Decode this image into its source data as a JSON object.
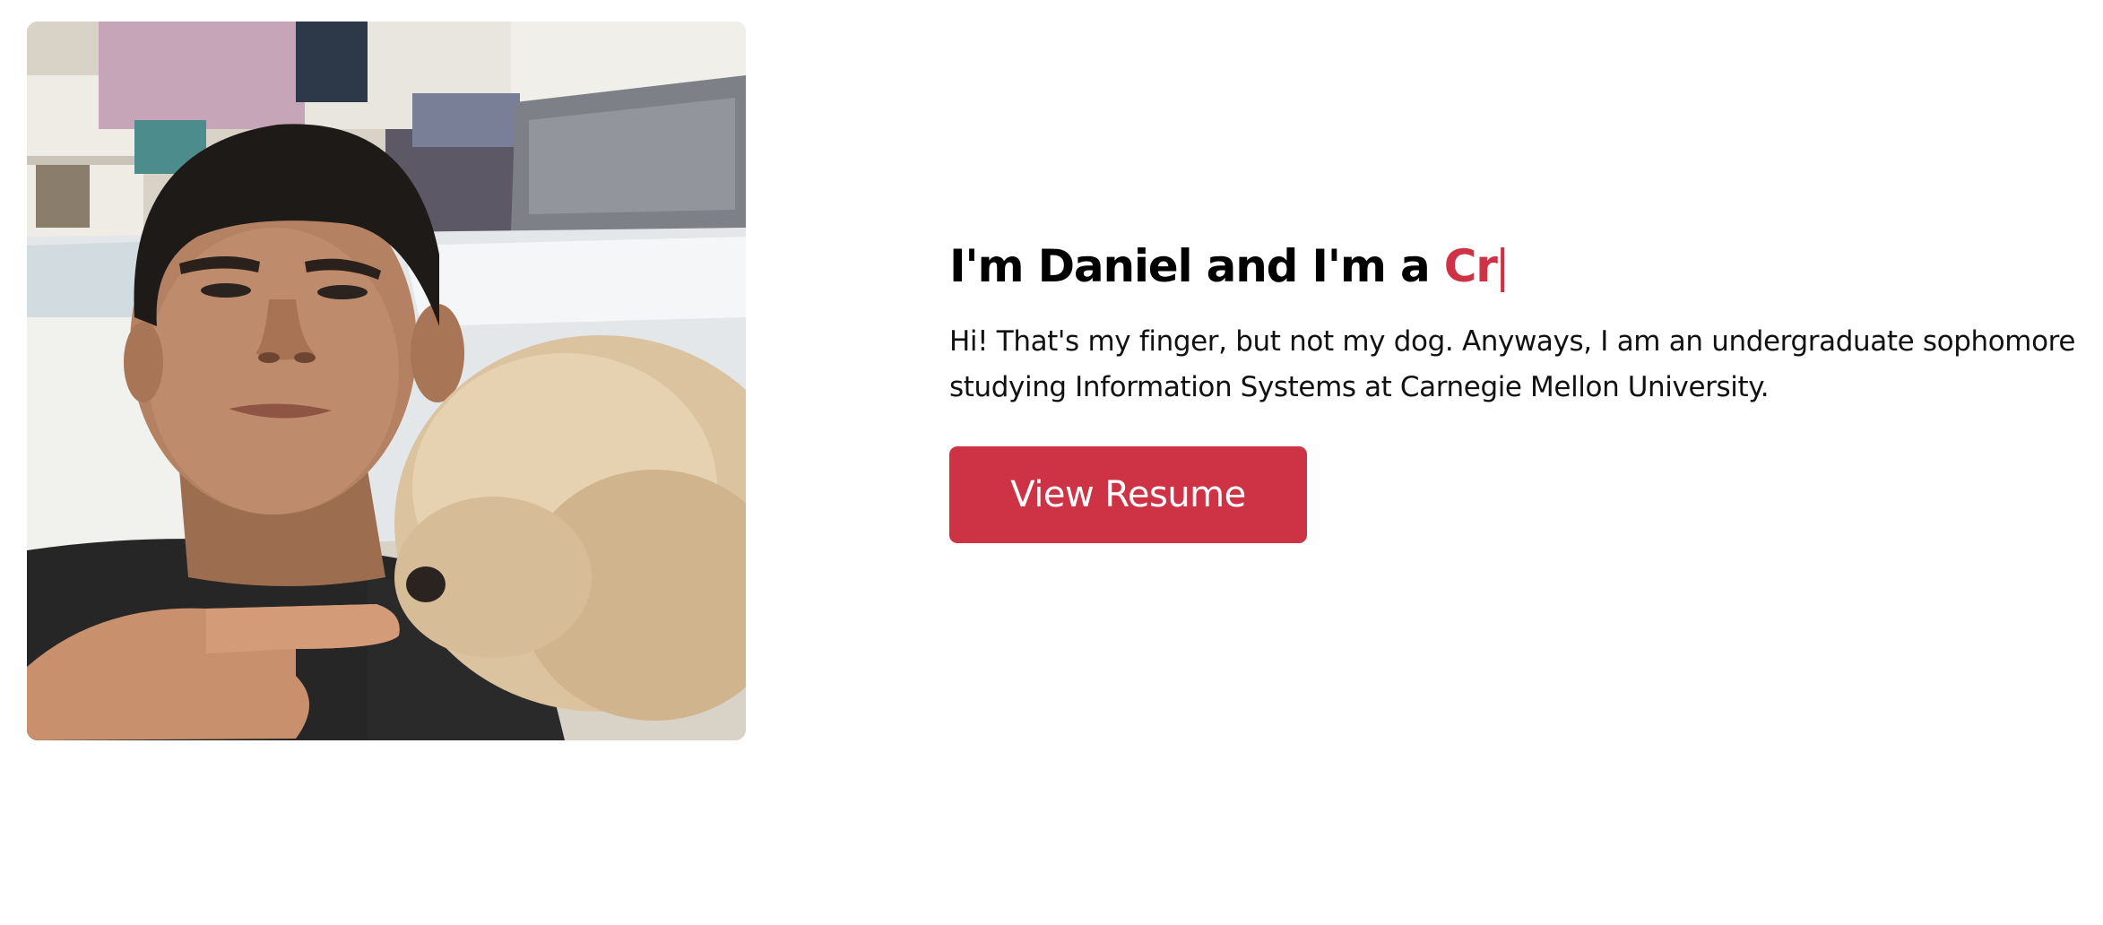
{
  "photo": {
    "alt": "Daniel lying in bed pointing at a fluffy cream-colored dog"
  },
  "intro": {
    "heading_prefix": "I'm Daniel and I'm a ",
    "heading_typed": "Cr",
    "cursor": "|",
    "bio": "Hi! That's my finger, but not my dog. Anyways, I am an undergraduate sophomore studying Information Systems at Carnegie Mellon University.",
    "resume_button_label": "View Resume"
  },
  "colors": {
    "accent": "#cd3345",
    "text": "#000000",
    "background": "#ffffff"
  }
}
